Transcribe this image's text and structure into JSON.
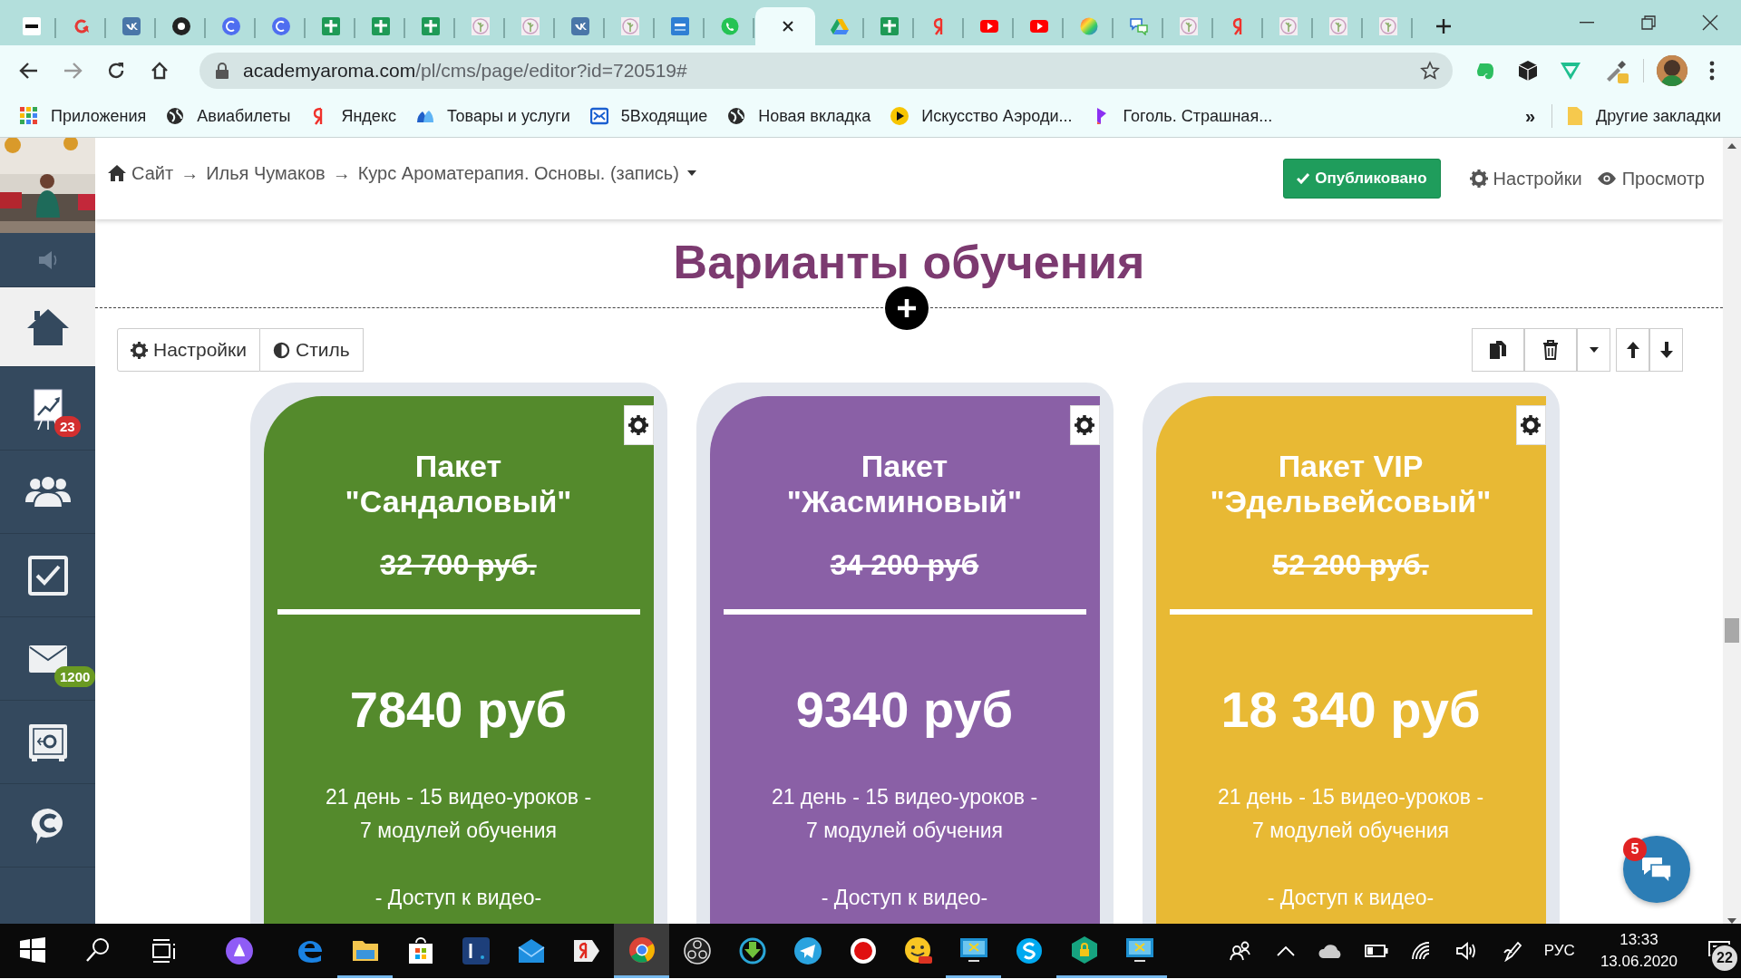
{
  "browser": {
    "tabs": [
      {
        "kind": "wix",
        "selected": false
      },
      {
        "kind": "refresh",
        "selected": false
      },
      {
        "kind": "vk",
        "selected": false
      },
      {
        "kind": "dot",
        "selected": false
      },
      {
        "kind": "c",
        "selected": false
      },
      {
        "kind": "c",
        "selected": false
      },
      {
        "kind": "sheets",
        "selected": false
      },
      {
        "kind": "sheets",
        "selected": false
      },
      {
        "kind": "sheets",
        "selected": false
      },
      {
        "kind": "leaf",
        "selected": false
      },
      {
        "kind": "leaf",
        "selected": false
      },
      {
        "kind": "vk",
        "selected": false
      },
      {
        "kind": "leaf",
        "selected": false
      },
      {
        "kind": "gc",
        "selected": false
      },
      {
        "kind": "whatsapp",
        "selected": false
      },
      {
        "kind": "blank",
        "selected": true
      },
      {
        "kind": "drive",
        "selected": false
      },
      {
        "kind": "sheets",
        "selected": false
      },
      {
        "kind": "yandex",
        "selected": false
      },
      {
        "kind": "youtube",
        "selected": false
      },
      {
        "kind": "youtube",
        "selected": false
      },
      {
        "kind": "colorwheel",
        "selected": false
      },
      {
        "kind": "chat",
        "selected": false
      },
      {
        "kind": "leaf",
        "selected": false
      },
      {
        "kind": "yandex",
        "selected": false
      },
      {
        "kind": "leaf",
        "selected": false
      },
      {
        "kind": "leaf",
        "selected": false
      },
      {
        "kind": "leaf",
        "selected": false
      }
    ],
    "address": {
      "host": "academyaroma.com",
      "path": "/pl/cms/page/editor?id=720519#"
    },
    "bookmarks": [
      {
        "kind": "apps",
        "label": "Приложения"
      },
      {
        "kind": "globe",
        "label": "Авиабилеты"
      },
      {
        "kind": "yandex",
        "label": "Яндекс"
      },
      {
        "kind": "cloud",
        "label": "Товары и услуги"
      },
      {
        "kind": "mail",
        "label": "5Входящие"
      },
      {
        "kind": "globe",
        "label": "Новая вкладка"
      },
      {
        "kind": "play",
        "label": "Искусство Аэроди..."
      },
      {
        "kind": "flag",
        "label": "Гоголь. Страшная..."
      }
    ],
    "more": "»",
    "other_bookmarks": "Другие закладки"
  },
  "sidebar": {
    "items": [
      {
        "kind": "sound",
        "selected": false
      },
      {
        "kind": "home",
        "selected": true
      },
      {
        "kind": "chart",
        "selected": false,
        "badge": "23",
        "color": "#d32f2f"
      },
      {
        "kind": "people",
        "selected": false
      },
      {
        "kind": "tasks",
        "selected": false
      },
      {
        "kind": "mail",
        "selected": false,
        "badge": "1200",
        "color": "#6a9a22"
      },
      {
        "kind": "safe",
        "selected": false
      },
      {
        "kind": "chat",
        "selected": false
      }
    ]
  },
  "header": {
    "breadcrumb": {
      "items": [
        "Сайт",
        "Илья Чумаков",
        "Курс Ароматерапия. Основы. (запись)"
      ],
      "separator": "→"
    },
    "published": "Опубликовано",
    "settings": "Настройки",
    "preview": "Просмотр"
  },
  "section": {
    "title": "Варианты обучения",
    "toolbar": [
      {
        "kind": "gear",
        "label": "Настройки"
      },
      {
        "kind": "contrast",
        "label": "Стиль"
      }
    ],
    "cards": [
      {
        "title": [
          "Пакет",
          "\"Сандаловый\""
        ],
        "old_price": "32 700 руб.",
        "price": "7840 руб",
        "details": [
          "21 день - 15 видео-уроков -",
          "7 модулей обучения"
        ],
        "more": "- Доступ к видео-",
        "color": "#548a2c"
      },
      {
        "title": [
          "Пакет",
          "\"Жасминовый\""
        ],
        "old_price": "34 200 руб",
        "price": "9340 руб",
        "details": [
          "21 день - 15 видео-уроков -",
          "7 модулей обучения"
        ],
        "more": "- Доступ к видео-",
        "color": "#8a60a6"
      },
      {
        "title": [
          "Пакет VIP",
          "\"Эдельвейсовый\""
        ],
        "old_price": "52 200 руб.",
        "price": "18 340 руб",
        "details": [
          "21 день - 15 видео-уроков -",
          "7 модулей обучения"
        ],
        "more": "- Доступ к видео-",
        "color": "#e8b934"
      }
    ]
  },
  "chat_widget": {
    "badge": "5"
  },
  "taskbar": {
    "items": [
      {
        "kind": "start",
        "running": false,
        "selected": false
      },
      {
        "kind": "search",
        "running": false,
        "selected": false
      },
      {
        "kind": "taskview",
        "running": false,
        "selected": false
      },
      {
        "kind": "alice",
        "running": false,
        "selected": false
      },
      {
        "kind": "edge",
        "running": false,
        "selected": false
      },
      {
        "kind": "explorer",
        "running": true,
        "selected": false
      },
      {
        "kind": "store",
        "running": false,
        "selected": false
      },
      {
        "kind": "booking",
        "running": false,
        "selected": false
      },
      {
        "kind": "mail",
        "running": false,
        "selected": false
      },
      {
        "kind": "yandex",
        "running": false,
        "selected": false
      },
      {
        "kind": "chrome",
        "running": true,
        "selected": true
      },
      {
        "kind": "obs",
        "running": false,
        "selected": false
      },
      {
        "kind": "download",
        "running": false,
        "selected": false
      },
      {
        "kind": "telegram",
        "running": false,
        "selected": false
      },
      {
        "kind": "record",
        "running": false,
        "selected": false
      },
      {
        "kind": "smiley",
        "running": false,
        "selected": false
      },
      {
        "kind": "scissors",
        "running": true,
        "selected": false
      },
      {
        "kind": "skype",
        "running": false,
        "selected": false
      },
      {
        "kind": "vpn",
        "running": true,
        "selected": false
      },
      {
        "kind": "scissors",
        "running": true,
        "selected": false
      }
    ],
    "language": "РУС",
    "time": "13:33",
    "date": "13.06.2020",
    "notifications": "22"
  }
}
